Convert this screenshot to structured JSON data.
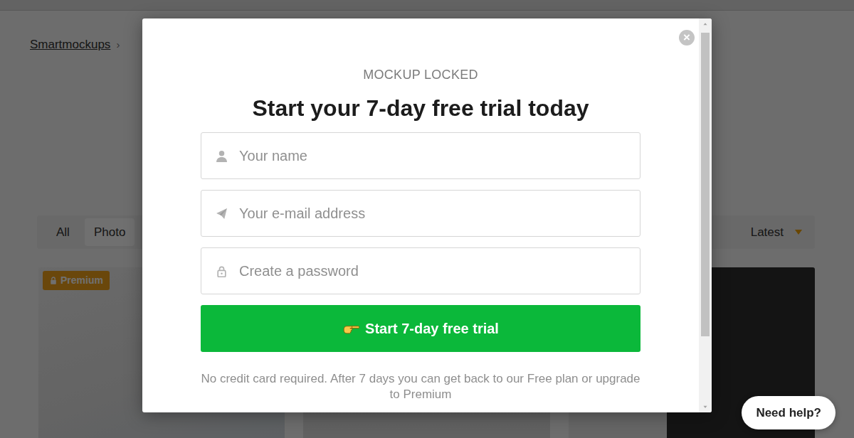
{
  "breadcrumb": {
    "label": "Smartmockups",
    "separator": "›"
  },
  "filters": [
    {
      "label": "All",
      "selected": false
    },
    {
      "label": "Photo",
      "selected": true
    }
  ],
  "sort": {
    "label": "Latest"
  },
  "cards": [
    {
      "premium": true,
      "badge": "Premium"
    },
    {
      "premium": false,
      "badge": ""
    },
    {
      "premium": false,
      "badge": ""
    }
  ],
  "modal": {
    "eyebrow": "MOCKUP LOCKED",
    "title": "Start your 7-day free trial today",
    "close": "×",
    "fields": [
      {
        "kind": "name",
        "placeholder": "Your name"
      },
      {
        "kind": "email",
        "placeholder": "Your e-mail address"
      },
      {
        "kind": "password",
        "placeholder": "Create a password"
      }
    ],
    "submit": "Start 7-day free trial",
    "note": "No credit card required. After 7 days you can get back to our Free plan or upgrade to Premium",
    "scroll": {
      "level": 0.83
    }
  },
  "help": "Need help?"
}
